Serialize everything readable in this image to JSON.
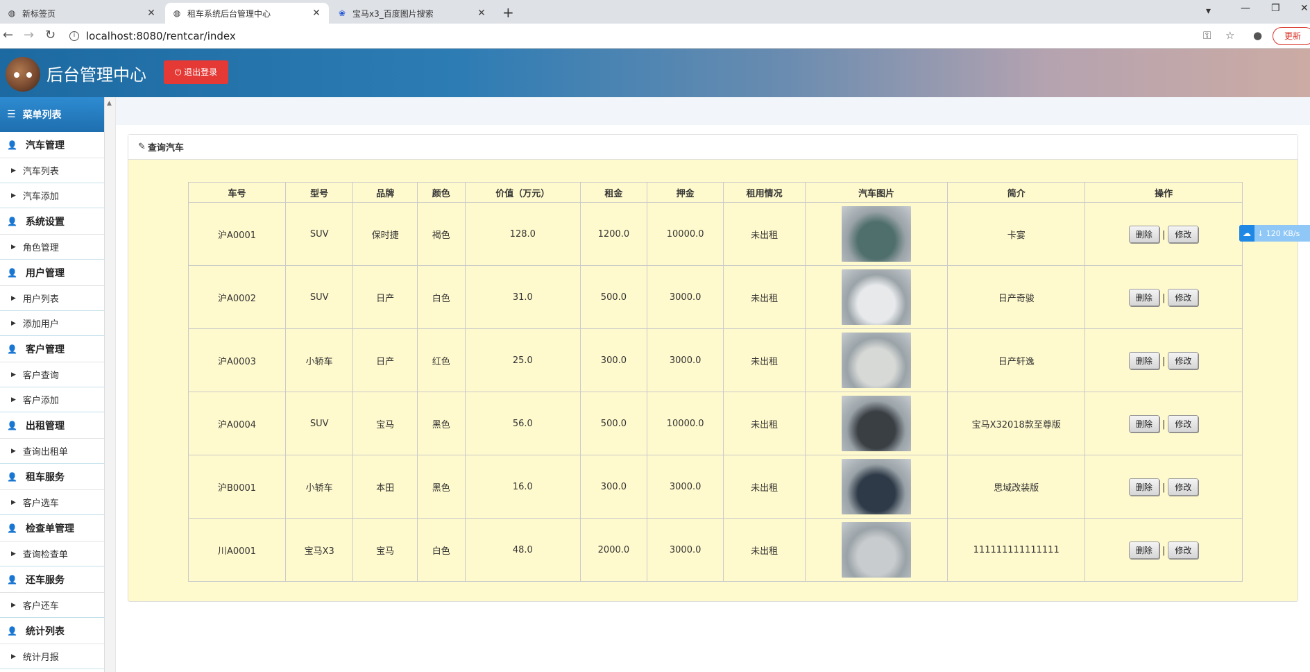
{
  "browser": {
    "tabs": [
      {
        "title": "新标签页",
        "icon": "globe-icon"
      },
      {
        "title": "租车系统后台管理中心",
        "icon": "globe-icon",
        "active": true
      },
      {
        "title": "宝马x3_百度图片搜索",
        "icon": "baidu-paw-icon"
      }
    ],
    "url": "localhost:8080/rentcar/index",
    "update_label": "更新"
  },
  "header": {
    "title": "后台管理中心",
    "logout_label": "退出登录"
  },
  "sidebar": {
    "title": "菜单列表",
    "groups": [
      {
        "label": "汽车管理",
        "items": [
          "汽车列表",
          "汽车添加"
        ]
      },
      {
        "label": "系统设置",
        "items": [
          "角色管理"
        ]
      },
      {
        "label": "用户管理",
        "items": [
          "用户列表",
          "添加用户"
        ]
      },
      {
        "label": "客户管理",
        "items": [
          "客户查询",
          "客户添加"
        ]
      },
      {
        "label": "出租管理",
        "items": [
          "查询出租单"
        ]
      },
      {
        "label": "租车服务",
        "items": [
          "客户选车"
        ]
      },
      {
        "label": "检查单管理",
        "items": [
          "查询检查单"
        ]
      },
      {
        "label": "还车服务",
        "items": [
          "客户还车"
        ]
      },
      {
        "label": "统计列表",
        "items": [
          "统计月报"
        ]
      }
    ]
  },
  "panel": {
    "title": "查询汽车"
  },
  "table": {
    "headers": [
      "车号",
      "型号",
      "品牌",
      "颜色",
      "价值（万元）",
      "租金",
      "押金",
      "租用情况",
      "汽车图片",
      "简介",
      "操作"
    ],
    "rows": [
      {
        "car_no": "沪A0001",
        "model": "SUV",
        "brand": "保时捷",
        "color": "褐色",
        "value": "128.0",
        "rent": "1200.0",
        "deposit": "10000.0",
        "status": "未出租",
        "intro": "卡宴",
        "img_color": "#4f6f6c"
      },
      {
        "car_no": "沪A0002",
        "model": "SUV",
        "brand": "日产",
        "color": "白色",
        "value": "31.0",
        "rent": "500.0",
        "deposit": "3000.0",
        "status": "未出租",
        "intro": "日产奇骏",
        "img_color": "#e7e9eb"
      },
      {
        "car_no": "沪A0003",
        "model": "小轿车",
        "brand": "日产",
        "color": "红色",
        "value": "25.0",
        "rent": "300.0",
        "deposit": "3000.0",
        "status": "未出租",
        "intro": "日产轩逸",
        "img_color": "#d7d9d6"
      },
      {
        "car_no": "沪A0004",
        "model": "SUV",
        "brand": "宝马",
        "color": "黑色",
        "value": "56.0",
        "rent": "500.0",
        "deposit": "10000.0",
        "status": "未出租",
        "intro": "宝马X32018款至尊版",
        "img_color": "#3a3f44"
      },
      {
        "car_no": "沪B0001",
        "model": "小轿车",
        "brand": "本田",
        "color": "黑色",
        "value": "16.0",
        "rent": "300.0",
        "deposit": "3000.0",
        "status": "未出租",
        "intro": "思域改装版",
        "img_color": "#2e3a48"
      },
      {
        "car_no": "川A0001",
        "model": "宝马X3",
        "brand": "宝马",
        "color": "白色",
        "value": "48.0",
        "rent": "2000.0",
        "deposit": "3000.0",
        "status": "未出租",
        "intro": "111111111111111",
        "img_color": "#c9ccce"
      }
    ],
    "delete_label": "删除",
    "edit_label": "修改",
    "separator": "|"
  },
  "speed_badge": "120 KB/s"
}
